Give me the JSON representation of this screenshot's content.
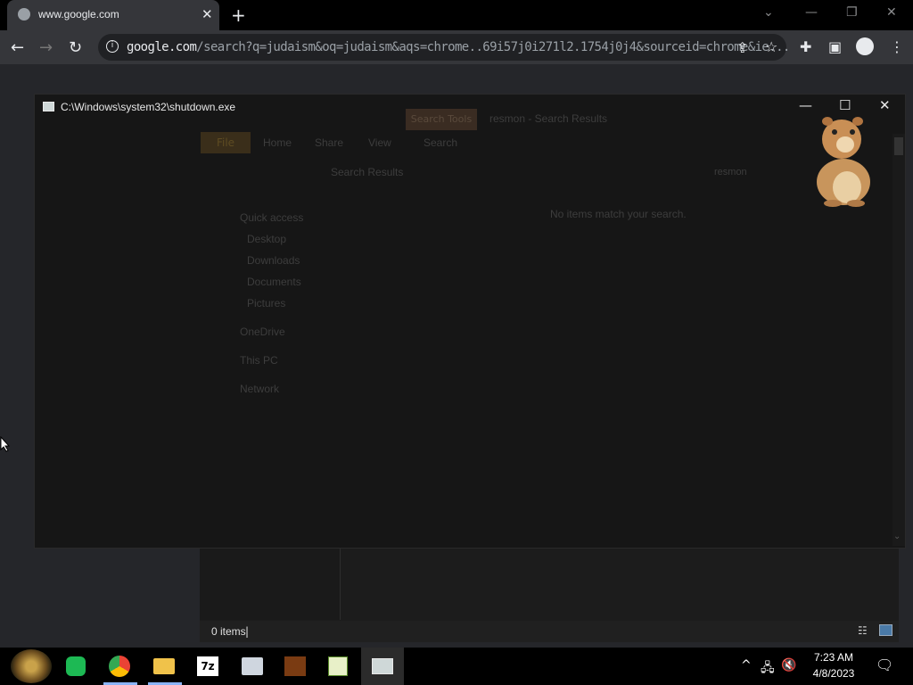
{
  "browser": {
    "tab_title": "www.google.com",
    "url_host": "google.com",
    "url_rest": "/search?q=judaism&oq=judaism&aqs=chrome..69i57j0i271l2.1754j0j4&sourceid=chrome&ie...",
    "new_tab_glyph": "+",
    "tab_close_glyph": "✕"
  },
  "console_window": {
    "title": "C:\\Windows\\system32\\shutdown.exe"
  },
  "explorer": {
    "tabs": [
      "Search Tools",
      "File",
      "Home",
      "Share",
      "View",
      "Search"
    ],
    "window_title": "resmon - Search Results",
    "address": "Search Results",
    "search_box": "resmon",
    "empty_message": "No items match your search.",
    "nav": [
      "Quick access",
      "Desktop",
      "Downloads",
      "Documents",
      "Pictures",
      "OneDrive",
      "This PC",
      "Network"
    ],
    "status": "0 items"
  },
  "taskbar": {
    "time": "7:23 AM",
    "date": "4/8/2023",
    "apps": [
      "fortress-icon",
      "spotify-icon",
      "chrome-icon",
      "file-explorer-icon",
      "7zip-icon",
      "network-icon",
      "media-icon",
      "notepad-icon",
      "console-icon"
    ]
  },
  "colors": {
    "chrome_dark": "#35363a",
    "tab_strip": "#000000",
    "console_bg": "#161616",
    "taskbar": "#000000"
  }
}
